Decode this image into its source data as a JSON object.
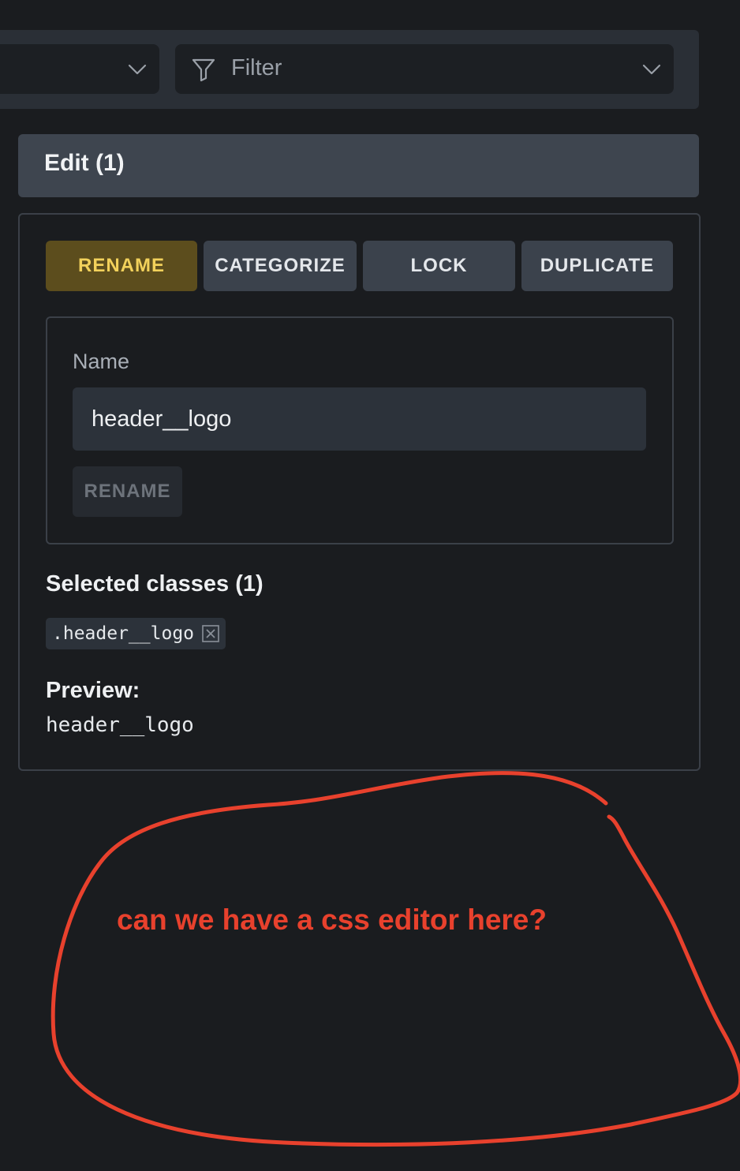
{
  "toolbar": {
    "filter_placeholder": "Filter",
    "icons": [
      "chevron-down-icon",
      "filter-icon"
    ]
  },
  "edit_section": {
    "title": "Edit (1)",
    "actions": {
      "rename": "RENAME",
      "categorize": "CATEGORIZE",
      "lock": "LOCK",
      "duplicate": "DUPLICATE"
    },
    "active_action": "rename",
    "rename_form": {
      "label": "Name",
      "value": "header__logo",
      "submit_label": "RENAME"
    },
    "selected_classes": {
      "title": "Selected classes (1)",
      "items": [
        ".header__logo"
      ]
    },
    "preview": {
      "title": "Preview:",
      "value": "header__logo"
    }
  },
  "annotation": {
    "text": "can we have a css editor here?",
    "color": "#e8412d"
  },
  "colors": {
    "background": "#1a1c1f",
    "accent_button_bg": "#5c4d1d",
    "accent_button_text": "#f2d15b"
  }
}
